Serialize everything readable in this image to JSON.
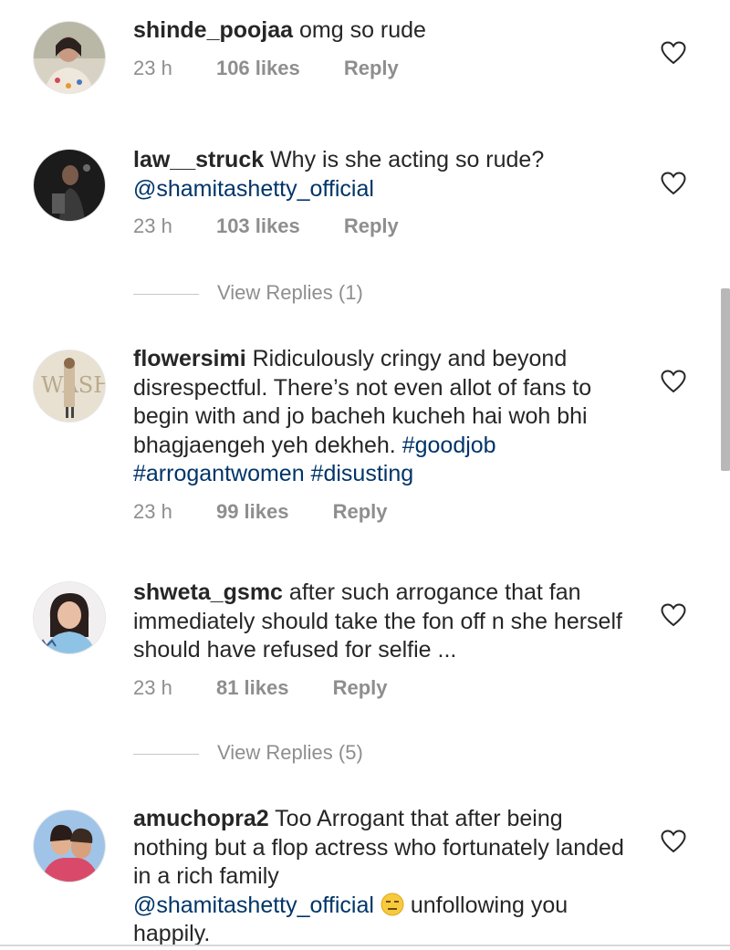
{
  "comments": [
    {
      "username": "shinde_poojaa",
      "text": " omg so rude",
      "time": "23 h",
      "likes": "106 likes",
      "reply": "Reply"
    },
    {
      "username": "law__struck",
      "text": " Why is she acting so rude?",
      "mention": "@shamitashetty_official",
      "time": "23 h",
      "likes": "103 likes",
      "reply": "Reply",
      "view_replies": "View Replies (1)"
    },
    {
      "username": "flowersimi",
      "text": " Ridiculously cringy and beyond disrespectful. There’s not even allot of fans to begin with and jo bacheh kucheh hai woh bhi bhagjaengeh yeh dekheh. ",
      "hashtags": "#goodjob #arrogantwomen #disusting",
      "time": "23 h",
      "likes": "99 likes",
      "reply": "Reply"
    },
    {
      "username": "shweta_gsmc",
      "text": " after such arrogance that fan immediately should take the fon off n she herself should have refused for selfie ...",
      "time": "23 h",
      "likes": "81 likes",
      "reply": "Reply",
      "view_replies": "View Replies (5)"
    },
    {
      "username": "amuchopra2",
      "text": " Too Arrogant that after being nothing but a flop actress who fortunately landed in a rich family",
      "mention": "@shamitashetty_official",
      "text_after": " unfollowing you happily."
    }
  ],
  "icons": {
    "heart": "heart-outline-icon",
    "emoji": "expressionless-face-emoji"
  },
  "colors": {
    "text": "#262626",
    "meta": "#8e8e8e",
    "link": "#003569"
  }
}
